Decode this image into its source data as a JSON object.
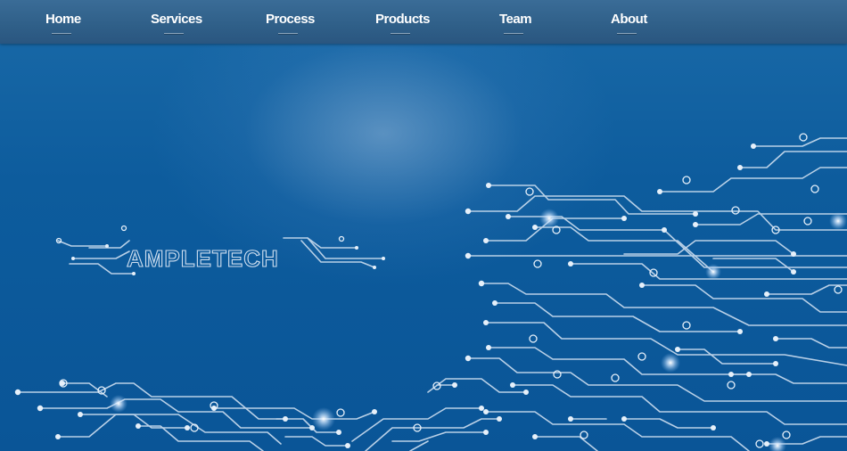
{
  "nav": {
    "items": [
      {
        "label": "Home"
      },
      {
        "label": "Services"
      },
      {
        "label": "Process"
      },
      {
        "label": "Products"
      },
      {
        "label": "Team"
      },
      {
        "label": "About"
      }
    ]
  },
  "logo": {
    "text": "AMPLETECH"
  },
  "colors": {
    "nav_bg": "#2f5f88",
    "hero_bg": "#0b5a98",
    "circuit": "#d8e6f4"
  }
}
